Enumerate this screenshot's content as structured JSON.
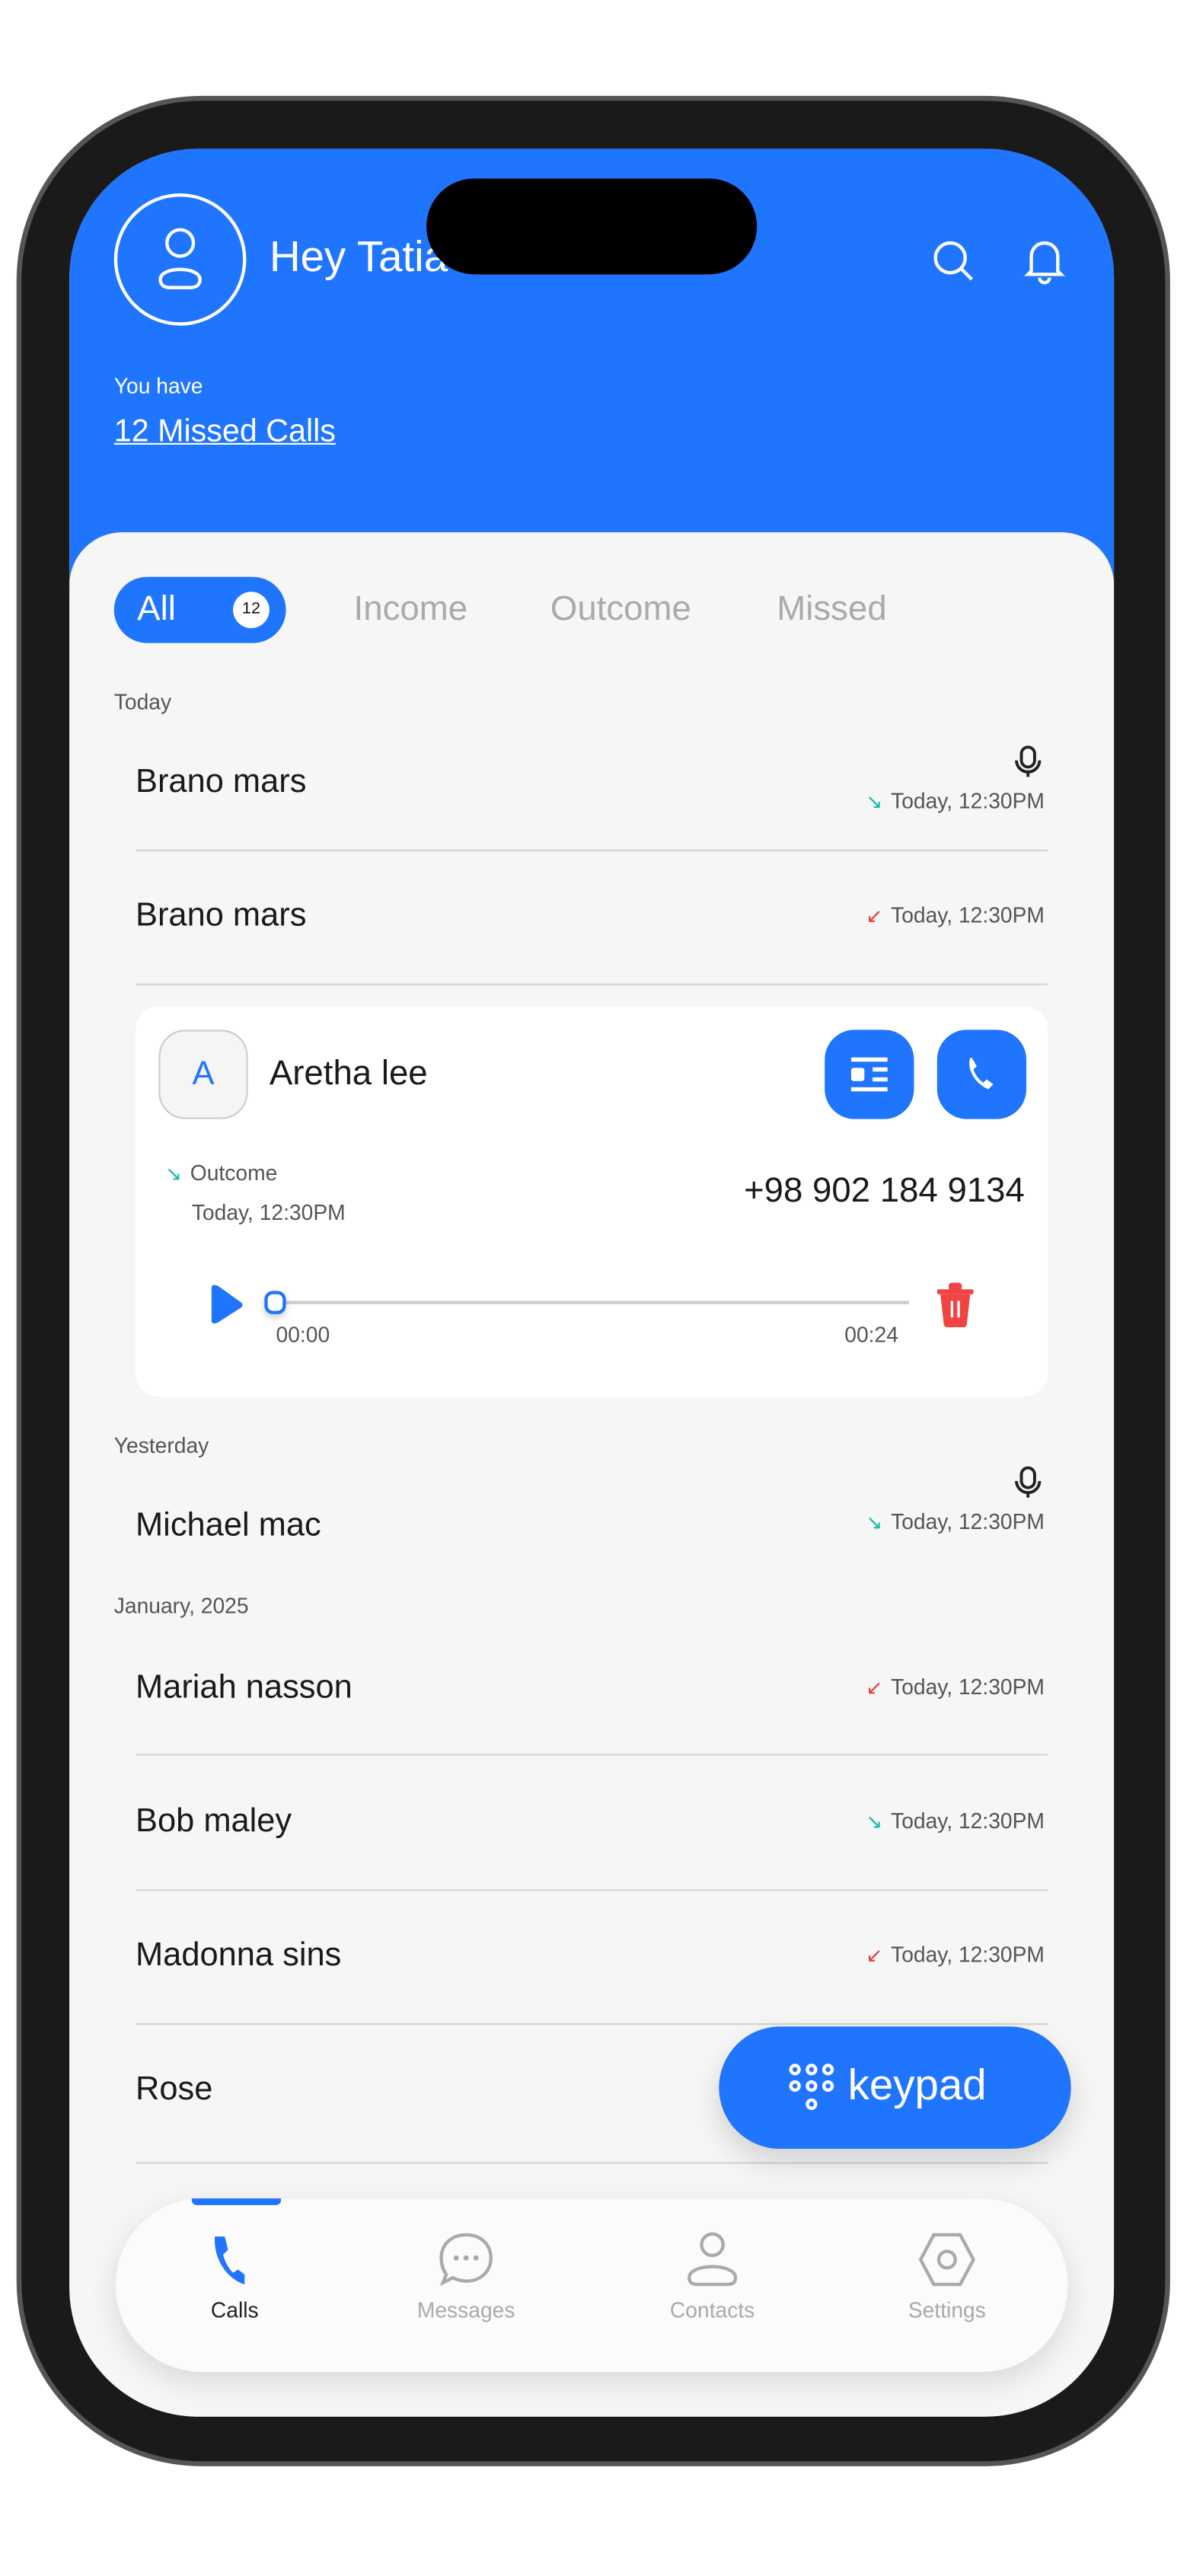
{
  "header": {
    "greeting": "Hey Tatia",
    "subtitle": "You have",
    "missed_link": "12 Missed Calls"
  },
  "tabs": [
    {
      "label": "All",
      "badge": "12",
      "active": true
    },
    {
      "label": "Income"
    },
    {
      "label": "Outcome"
    },
    {
      "label": "Missed"
    }
  ],
  "sections": {
    "today": "Today",
    "yesterday": "Yesterday",
    "january": "January, 2025"
  },
  "calls": [
    {
      "name": "Brano mars",
      "time": "Today, 12:30PM",
      "direction": "incoming",
      "recording": true
    },
    {
      "name": "Brano mars",
      "time": "Today, 12:30PM",
      "direction": "missed"
    },
    {
      "name": "Michael mac",
      "time": "Today, 12:30PM",
      "direction": "incoming",
      "recording": true
    },
    {
      "name": "Mariah nasson",
      "time": "Today, 12:30PM",
      "direction": "missed"
    },
    {
      "name": "Bob maley",
      "time": "Today, 12:30PM",
      "direction": "incoming"
    },
    {
      "name": "Madonna sins",
      "time": "Today, 12:30PM",
      "direction": "missed"
    },
    {
      "name": "Rose"
    }
  ],
  "expanded": {
    "initial": "A",
    "name": "Aretha lee",
    "type": "Outcome",
    "time": "Today, 12:30PM",
    "phone": "+98 902 184 9134",
    "elapsed": "00:00",
    "duration": "00:24",
    "progress": 0
  },
  "keypad_label": "keypad",
  "nav": [
    {
      "label": "Calls",
      "active": true
    },
    {
      "label": "Messages"
    },
    {
      "label": "Contacts"
    },
    {
      "label": "Settings"
    }
  ],
  "colors": {
    "accent": "#1f75fe",
    "incoming": "#14b8a6",
    "missed": "#e53e3e",
    "delete": "#f04444"
  }
}
